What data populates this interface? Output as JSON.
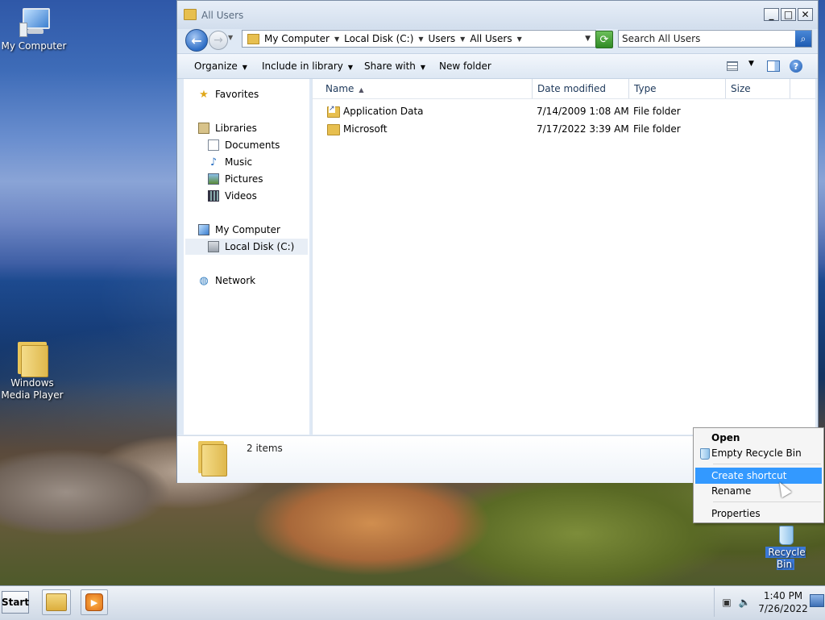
{
  "desktop": {
    "icons": [
      {
        "label": "My Computer"
      },
      {
        "label": "Windows Media Player"
      },
      {
        "label": "Recycle Bin"
      }
    ]
  },
  "window": {
    "title": "All Users",
    "controls": {
      "minimize": "_",
      "maximize": "□",
      "close": "✕"
    },
    "breadcrumbs": [
      "My Computer",
      "Local Disk (C:)",
      "Users",
      "All Users"
    ],
    "search": {
      "placeholder": "Search All Users"
    },
    "toolbar": {
      "organize": "Organize",
      "include_in_library": "Include in library",
      "share_with": "Share with",
      "new_folder": "New folder"
    },
    "nav": {
      "favorites": "Favorites",
      "libraries": "Libraries",
      "documents": "Documents",
      "music": "Music",
      "pictures": "Pictures",
      "videos": "Videos",
      "my_computer": "My Computer",
      "local_disk": "Local Disk (C:)",
      "network": "Network"
    },
    "columns": [
      "Name",
      "Date modified",
      "Type",
      "Size"
    ],
    "files": [
      {
        "name": "Application Data",
        "date": "7/14/2009 1:08 AM",
        "type": "File folder",
        "size": ""
      },
      {
        "name": "Microsoft",
        "date": "7/17/2022 3:39 AM",
        "type": "File folder",
        "size": ""
      }
    ],
    "details": {
      "count": "2 items"
    }
  },
  "context_menu": {
    "items": [
      "Open",
      "Empty Recycle Bin",
      "Create shortcut",
      "Rename",
      "Properties"
    ],
    "highlighted": "Create shortcut"
  },
  "taskbar": {
    "start": "Start",
    "clock": {
      "time": "1:40 PM",
      "date": "7/26/2022"
    }
  },
  "colors": {
    "highlight": "#3399ff",
    "link_text": "#1e395b"
  }
}
